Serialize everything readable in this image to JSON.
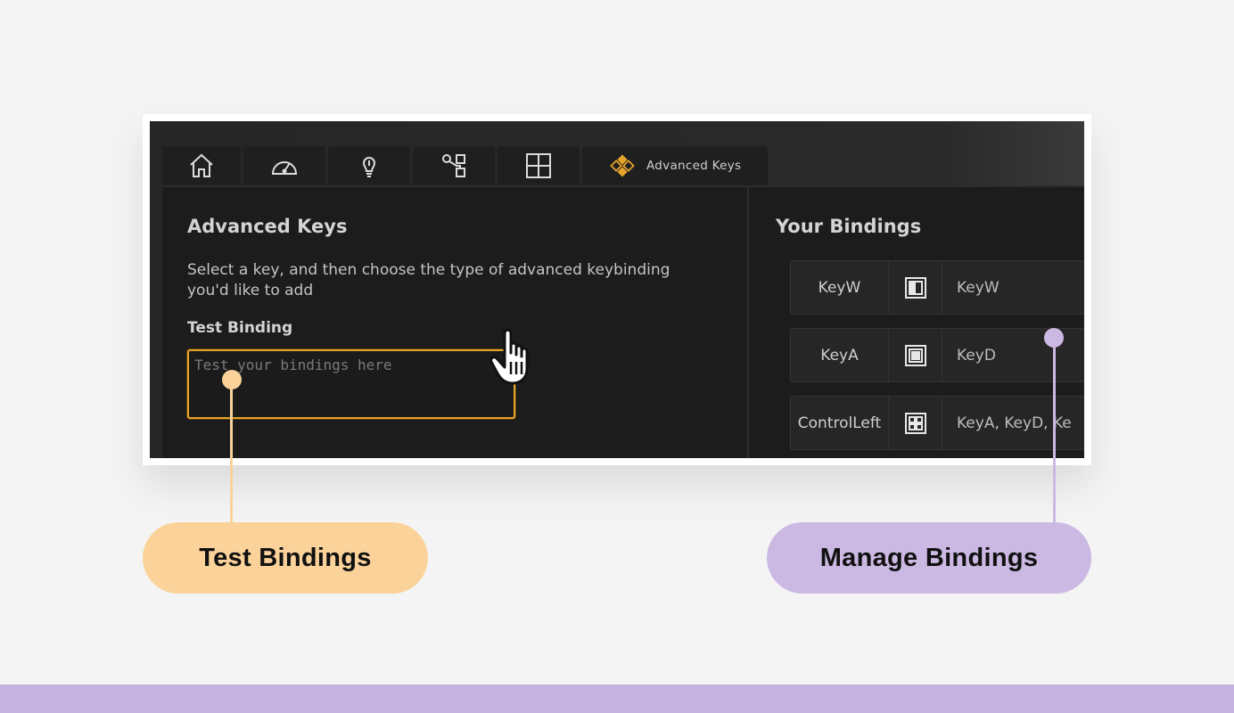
{
  "colors": {
    "background": "#f4f4f4",
    "accent_orange": "#e6a52a",
    "callout_peach": "#fbd39a",
    "callout_lavender": "#cbb9e3",
    "bottom_band": "#c6b3e0"
  },
  "tabs": [
    {
      "icon": "home-icon"
    },
    {
      "icon": "speedometer-icon"
    },
    {
      "icon": "lightbulb-icon"
    },
    {
      "icon": "nodes-icon"
    },
    {
      "icon": "plus-box-icon"
    },
    {
      "icon": "advanced-keys-icon",
      "label": "Advanced Keys"
    }
  ],
  "left": {
    "title": "Advanced Keys",
    "description": "Select a key, and then choose the type of advanced keybinding you'd like to add",
    "test_label": "Test Binding",
    "test_placeholder": "Test your bindings here"
  },
  "right": {
    "title": "Your Bindings",
    "bindings": [
      {
        "key": "KeyW",
        "type_icon": "half-square-icon",
        "value": "KeyW"
      },
      {
        "key": "KeyA",
        "type_icon": "nested-square-icon",
        "value": "KeyD"
      },
      {
        "key": "ControlLeft",
        "type_icon": "grid-square-icon",
        "value": "KeyA, KeyD, Ke"
      }
    ]
  },
  "callouts": {
    "test": "Test Bindings",
    "manage": "Manage Bindings"
  }
}
